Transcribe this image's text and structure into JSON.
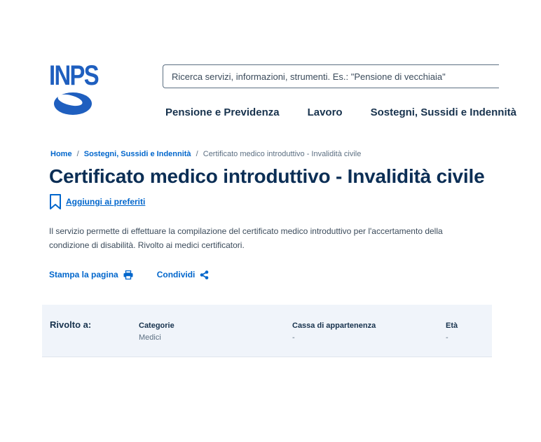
{
  "logo": {
    "text": "INPS"
  },
  "search": {
    "placeholder": "Ricerca servizi, informazioni, strumenti. Es.: \"Pensione di vecchiaia\""
  },
  "nav": {
    "items": [
      {
        "label": "Pensione e Previdenza"
      },
      {
        "label": "Lavoro"
      },
      {
        "label": "Sostegni, Sussidi e Indennità"
      }
    ]
  },
  "breadcrumb": {
    "home": "Home",
    "sep": "/",
    "section": "Sostegni, Sussidi e Indennità",
    "current": "Certificato medico introduttivo - Invalidità civile"
  },
  "page": {
    "title": "Certificato medico introduttivo - Invalidità civile",
    "favorite_label": "Aggiungi ai preferiti",
    "description": "Il servizio permette di effettuare la compilazione del certificato medico introduttivo per l'accertamento della condizione di disabilità. Rivolto ai medici certificatori."
  },
  "actions": {
    "print_label": "Stampa la pagina",
    "share_label": "Condividi"
  },
  "audience": {
    "label": "Rivolto a:",
    "columns": [
      {
        "header": "Categorie",
        "value": "Medici"
      },
      {
        "header": "Cassa di appartenenza",
        "value": "-"
      },
      {
        "header": "Età",
        "value": "-"
      }
    ]
  },
  "colors": {
    "primary": "#0066cc",
    "title": "#0b2e55",
    "logo": "#1f5fbf",
    "panel_bg": "#f0f4fa"
  }
}
